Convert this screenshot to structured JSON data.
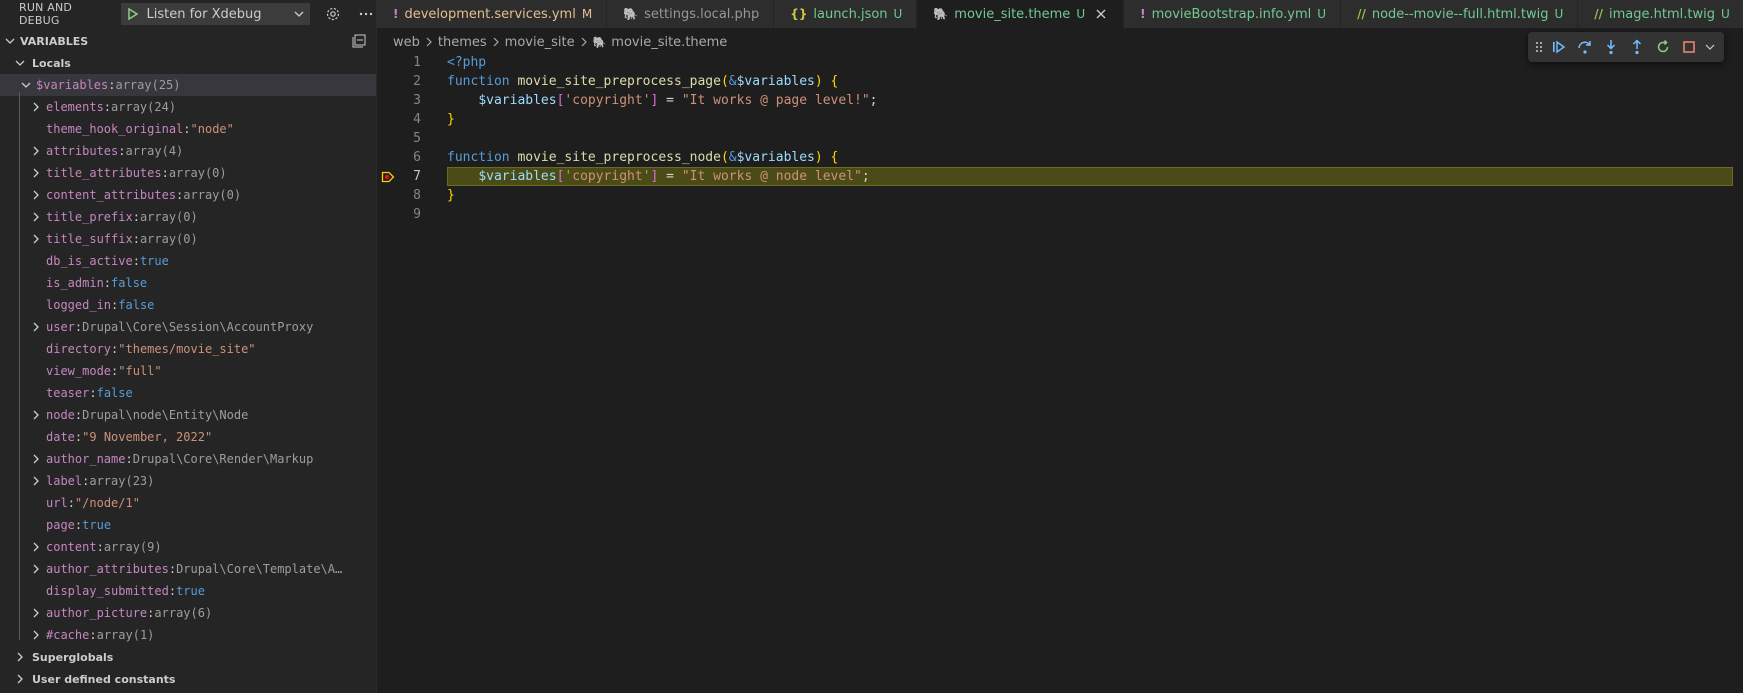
{
  "sidebar": {
    "title": "RUN AND DEBUG",
    "config": "Listen for Xdebug",
    "variables_header": "VARIABLES",
    "locals": "Locals",
    "root_var": {
      "name": "$variables",
      "value": "array(25)"
    },
    "vars": [
      {
        "name": "elements",
        "value": "array(24)",
        "kind": "array",
        "expandable": true
      },
      {
        "name": "theme_hook_original",
        "value": "\"node\"",
        "kind": "str",
        "expandable": false
      },
      {
        "name": "attributes",
        "value": "array(4)",
        "kind": "array",
        "expandable": true
      },
      {
        "name": "title_attributes",
        "value": "array(0)",
        "kind": "array",
        "expandable": true
      },
      {
        "name": "content_attributes",
        "value": "array(0)",
        "kind": "array",
        "expandable": true
      },
      {
        "name": "title_prefix",
        "value": "array(0)",
        "kind": "array",
        "expandable": true
      },
      {
        "name": "title_suffix",
        "value": "array(0)",
        "kind": "array",
        "expandable": true
      },
      {
        "name": "db_is_active",
        "value": "true",
        "kind": "bool",
        "expandable": false
      },
      {
        "name": "is_admin",
        "value": "false",
        "kind": "bool",
        "expandable": false
      },
      {
        "name": "logged_in",
        "value": "false",
        "kind": "bool",
        "expandable": false
      },
      {
        "name": "user",
        "value": "Drupal\\Core\\Session\\AccountProxy",
        "kind": "obj",
        "expandable": true
      },
      {
        "name": "directory",
        "value": "\"themes/movie_site\"",
        "kind": "str",
        "expandable": false
      },
      {
        "name": "view_mode",
        "value": "\"full\"",
        "kind": "str",
        "expandable": false
      },
      {
        "name": "teaser",
        "value": "false",
        "kind": "bool",
        "expandable": false
      },
      {
        "name": "node",
        "value": "Drupal\\node\\Entity\\Node",
        "kind": "obj",
        "expandable": true
      },
      {
        "name": "date",
        "value": "\"9  November,  2022\"",
        "kind": "str",
        "expandable": false
      },
      {
        "name": "author_name",
        "value": "Drupal\\Core\\Render\\Markup",
        "kind": "obj",
        "expandable": true
      },
      {
        "name": "label",
        "value": "array(23)",
        "kind": "array",
        "expandable": true
      },
      {
        "name": "url",
        "value": "\"/node/1\"",
        "kind": "str",
        "expandable": false
      },
      {
        "name": "page",
        "value": "true",
        "kind": "bool",
        "expandable": false
      },
      {
        "name": "content",
        "value": "array(9)",
        "kind": "array",
        "expandable": true
      },
      {
        "name": "author_attributes",
        "value": "Drupal\\Core\\Template\\A…",
        "kind": "obj",
        "expandable": true
      },
      {
        "name": "display_submitted",
        "value": "true",
        "kind": "bool",
        "expandable": false
      },
      {
        "name": "author_picture",
        "value": "array(6)",
        "kind": "array",
        "expandable": true
      },
      {
        "name": "#cache",
        "value": "array(1)",
        "kind": "array",
        "expandable": true
      }
    ],
    "superglobals": "Superglobals",
    "user_constants": "User defined constants"
  },
  "tabs": [
    {
      "icon": "!",
      "icon_color": "#c586c0",
      "label": "development.services.yml",
      "label_color": "#e2c08d",
      "status": "M",
      "status_color": "#e2c08d",
      "active": false
    },
    {
      "icon": "🐘",
      "icon_color": "#8993be",
      "label": "settings.local.php",
      "label_color": "#969696",
      "status": "",
      "status_color": "",
      "active": false
    },
    {
      "icon": "{}",
      "icon_color": "#cbcb41",
      "label": "launch.json",
      "label_color": "#73c991",
      "status": "U",
      "status_color": "#73c991",
      "active": false
    },
    {
      "icon": "🐘",
      "icon_color": "#8993be",
      "label": "movie_site.theme",
      "label_color": "#73c991",
      "status": "U",
      "status_color": "#73c991",
      "active": true
    },
    {
      "icon": "!",
      "icon_color": "#c586c0",
      "label": "movieBootstrap.info.yml",
      "label_color": "#73c991",
      "status": "U",
      "status_color": "#73c991",
      "active": false
    },
    {
      "icon": "//",
      "icon_color": "#8dc149",
      "label": "node--movie--full.html.twig",
      "label_color": "#73c991",
      "status": "U",
      "status_color": "#73c991",
      "active": false
    },
    {
      "icon": "//",
      "icon_color": "#8dc149",
      "label": "image.html.twig",
      "label_color": "#73c991",
      "status": "U",
      "status_color": "#73c991",
      "active": false
    }
  ],
  "breadcrumb": [
    "web",
    "themes",
    "movie_site",
    "movie_site.theme"
  ],
  "editor": {
    "current_line": 7,
    "lines": [
      {
        "n": "1",
        "tokens": [
          {
            "t": "<?php",
            "c": "k"
          }
        ]
      },
      {
        "n": "2",
        "tokens": [
          {
            "t": "function ",
            "c": "k"
          },
          {
            "t": "movie_site_preprocess_page",
            "c": "f"
          },
          {
            "t": "(",
            "c": "b1"
          },
          {
            "t": "&",
            "c": "k"
          },
          {
            "t": "$variables",
            "c": "v"
          },
          {
            "t": ")",
            "c": "b1"
          },
          {
            "t": " ",
            "c": "p"
          },
          {
            "t": "{",
            "c": "b1"
          }
        ]
      },
      {
        "n": "3",
        "tokens": [
          {
            "t": "    ",
            "c": "p"
          },
          {
            "t": "$variables",
            "c": "v"
          },
          {
            "t": "[",
            "c": "b2"
          },
          {
            "t": "'copyright'",
            "c": "s"
          },
          {
            "t": "]",
            "c": "b2"
          },
          {
            "t": " = ",
            "c": "p"
          },
          {
            "t": "\"It works @ page level!\"",
            "c": "s"
          },
          {
            "t": ";",
            "c": "p"
          }
        ]
      },
      {
        "n": "4",
        "tokens": [
          {
            "t": "}",
            "c": "b1"
          }
        ]
      },
      {
        "n": "5",
        "tokens": []
      },
      {
        "n": "6",
        "tokens": [
          {
            "t": "function ",
            "c": "k"
          },
          {
            "t": "movie_site_preprocess_node",
            "c": "f"
          },
          {
            "t": "(",
            "c": "b1"
          },
          {
            "t": "&",
            "c": "k"
          },
          {
            "t": "$variables",
            "c": "v"
          },
          {
            "t": ")",
            "c": "b1"
          },
          {
            "t": " ",
            "c": "p"
          },
          {
            "t": "{",
            "c": "b1"
          }
        ]
      },
      {
        "n": "7",
        "tokens": [
          {
            "t": "    ",
            "c": "p"
          },
          {
            "t": "$variables",
            "c": "v"
          },
          {
            "t": "[",
            "c": "b2"
          },
          {
            "t": "'copyright'",
            "c": "s"
          },
          {
            "t": "]",
            "c": "b2"
          },
          {
            "t": " = ",
            "c": "p"
          },
          {
            "t": "\"It works @ node level\"",
            "c": "s"
          },
          {
            "t": ";",
            "c": "p"
          }
        ]
      },
      {
        "n": "8",
        "tokens": [
          {
            "t": "}",
            "c": "b1"
          }
        ]
      },
      {
        "n": "9",
        "tokens": []
      }
    ]
  },
  "debug_toolbar": [
    "continue-icon",
    "step-over-icon",
    "step-into-icon",
    "step-out-icon",
    "restart-icon",
    "stop-icon"
  ]
}
